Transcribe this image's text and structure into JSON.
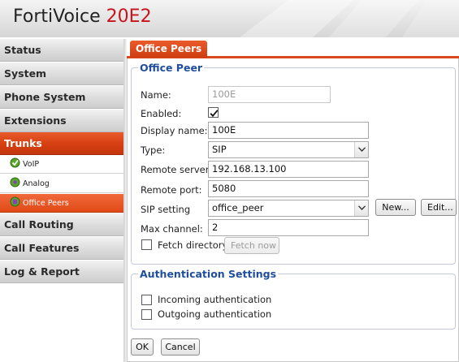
{
  "header": {
    "product_name": "FortiVoice",
    "product_model": "20E2"
  },
  "sidebar": {
    "items": [
      {
        "label": "Status"
      },
      {
        "label": "System"
      },
      {
        "label": "Phone System"
      },
      {
        "label": "Extensions"
      },
      {
        "label": "Trunks",
        "active": true
      },
      {
        "label": "Call Routing"
      },
      {
        "label": "Call Features"
      },
      {
        "label": "Log & Report"
      }
    ],
    "subitems": [
      {
        "label": "VoIP",
        "icon": "voip-icon"
      },
      {
        "label": "Analog",
        "icon": "analog-icon"
      },
      {
        "label": "Office Peers",
        "icon": "office-peers-icon",
        "active": true
      }
    ]
  },
  "tab": {
    "label": "Office Peers"
  },
  "office_peer": {
    "legend": "Office Peer",
    "name_label": "Name:",
    "name_value": "100E",
    "enabled_label": "Enabled:",
    "enabled_checked": true,
    "display_name_label": "Display name:",
    "display_name_value": "100E",
    "type_label": "Type:",
    "type_value": "SIP",
    "remote_server_label": "Remote server:",
    "remote_server_value": "192.168.13.100",
    "remote_port_label": "Remote port:",
    "remote_port_value": "5080",
    "sip_setting_label": "SIP setting",
    "sip_setting_value": "office_peer",
    "new_button": "New...",
    "edit_button": "Edit...",
    "max_channel_label": "Max channel:",
    "max_channel_value": "2",
    "fetch_directory_label": "Fetch directory",
    "fetch_directory_checked": false,
    "fetch_now_button": "Fetch now"
  },
  "auth": {
    "legend": "Authentication Settings",
    "incoming_label": "Incoming authentication",
    "incoming_checked": false,
    "outgoing_label": "Outgoing authentication",
    "outgoing_checked": false
  },
  "footer": {
    "ok_button": "OK",
    "cancel_button": "Cancel"
  },
  "colors": {
    "brand_red": "#c6141b",
    "active_orange": "#d63f11",
    "legend_blue": "#1f4e9c"
  }
}
